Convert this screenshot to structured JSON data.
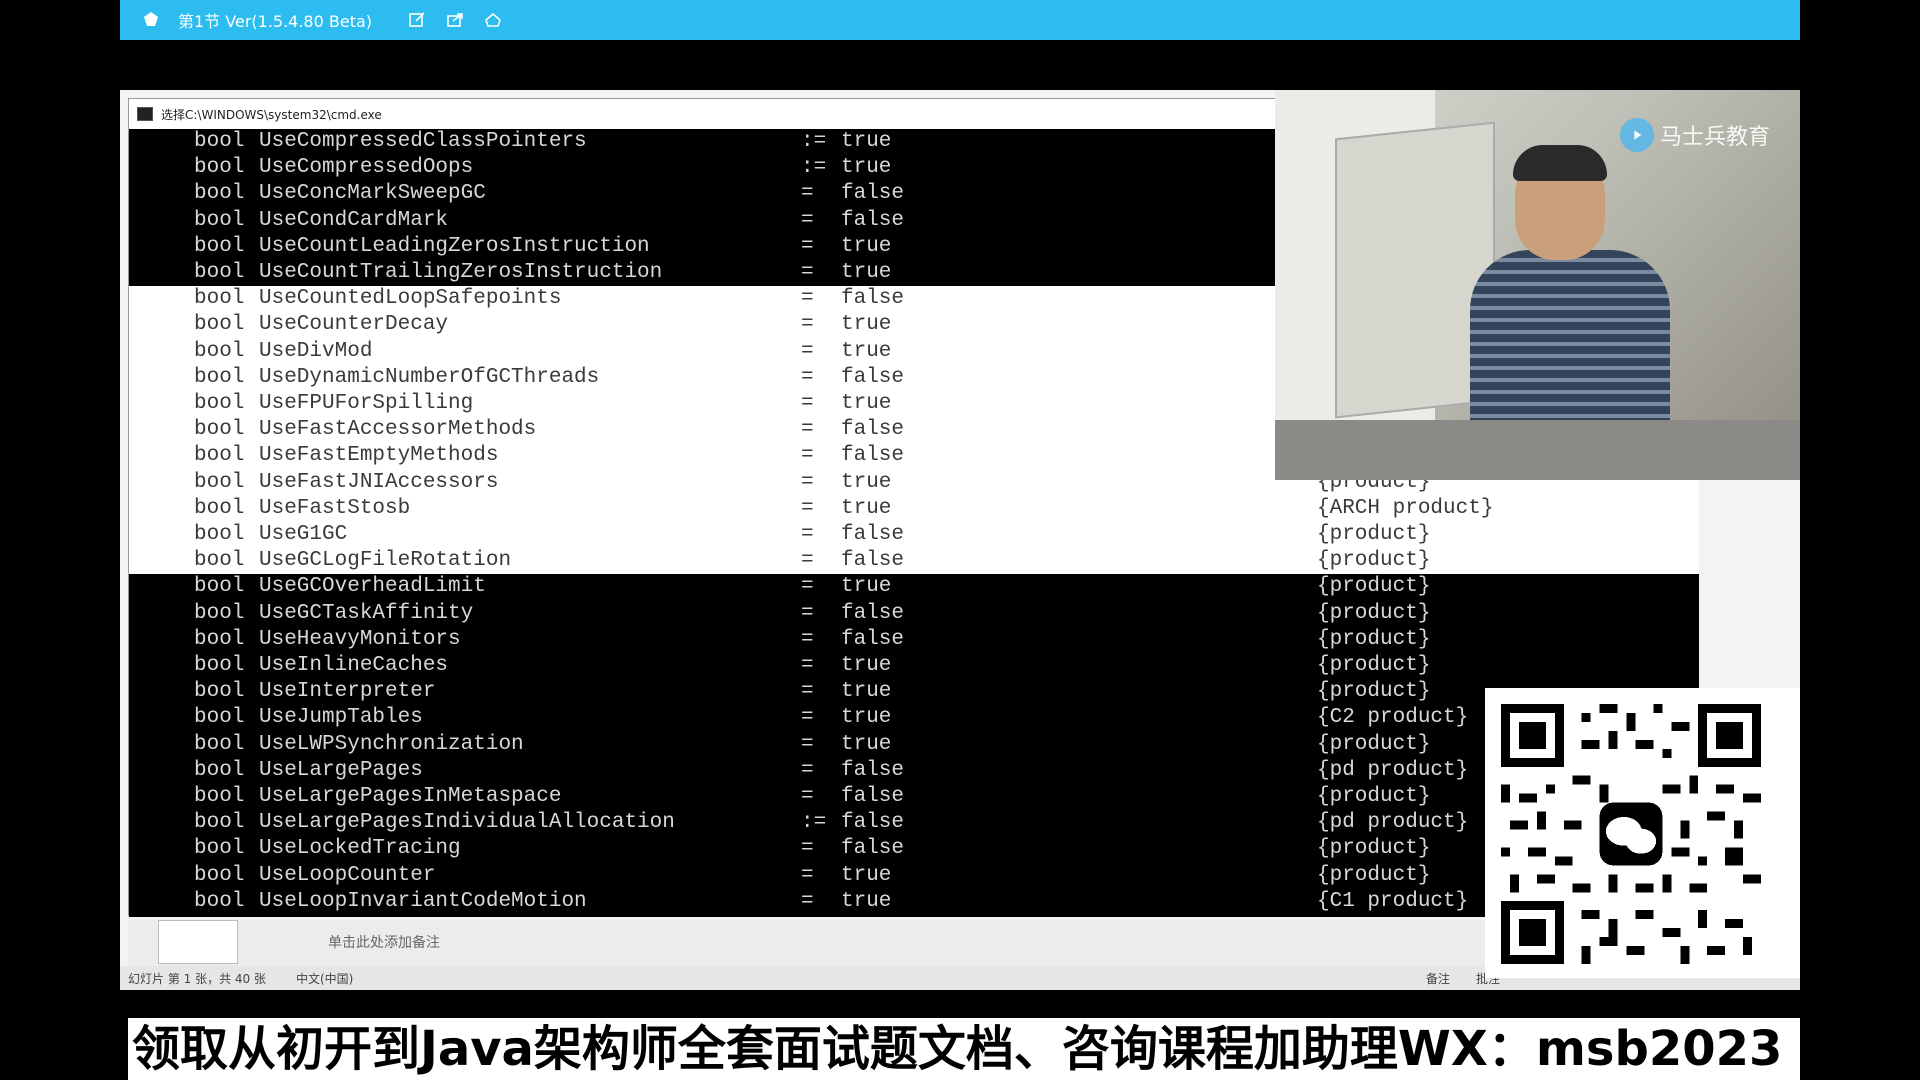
{
  "app": {
    "title": "第1节 Ver(1.5.4.80 Beta)"
  },
  "cmd": {
    "window_title": "选择C:\\WINDOWS\\system32\\cmd.exe",
    "rows": [
      {
        "type": "bool",
        "name": "UseCompressedClassPointers",
        "op": ":=",
        "value": "true",
        "kind": "",
        "selected": false
      },
      {
        "type": "bool",
        "name": "UseCompressedOops",
        "op": ":=",
        "value": "true",
        "kind": "",
        "selected": false
      },
      {
        "type": "bool",
        "name": "UseConcMarkSweepGC",
        "op": "=",
        "value": "false",
        "kind": "",
        "selected": false
      },
      {
        "type": "bool",
        "name": "UseCondCardMark",
        "op": "=",
        "value": "false",
        "kind": "",
        "selected": false
      },
      {
        "type": "bool",
        "name": "UseCountLeadingZerosInstruction",
        "op": "=",
        "value": "true",
        "kind": "",
        "selected": false
      },
      {
        "type": "bool",
        "name": "UseCountTrailingZerosInstruction",
        "op": "=",
        "value": "true",
        "kind": "",
        "selected": false
      },
      {
        "type": "bool",
        "name": "UseCountedLoopSafepoints",
        "op": "=",
        "value": "false",
        "kind": "",
        "selected": true
      },
      {
        "type": "bool",
        "name": "UseCounterDecay",
        "op": "=",
        "value": "true",
        "kind": "",
        "selected": true
      },
      {
        "type": "bool",
        "name": "UseDivMod",
        "op": "=",
        "value": "true",
        "kind": "",
        "selected": true
      },
      {
        "type": "bool",
        "name": "UseDynamicNumberOfGCThreads",
        "op": "=",
        "value": "false",
        "kind": "",
        "selected": true
      },
      {
        "type": "bool",
        "name": "UseFPUForSpilling",
        "op": "=",
        "value": "true",
        "kind": "",
        "selected": true
      },
      {
        "type": "bool",
        "name": "UseFastAccessorMethods",
        "op": "=",
        "value": "false",
        "kind": "",
        "selected": true
      },
      {
        "type": "bool",
        "name": "UseFastEmptyMethods",
        "op": "=",
        "value": "false",
        "kind": "",
        "selected": true
      },
      {
        "type": "bool",
        "name": "UseFastJNIAccessors",
        "op": "=",
        "value": "true",
        "kind": "{product}",
        "selected": true
      },
      {
        "type": "bool",
        "name": "UseFastStosb",
        "op": "=",
        "value": "true",
        "kind": "{ARCH product}",
        "selected": true
      },
      {
        "type": "bool",
        "name": "UseG1GC",
        "op": "=",
        "value": "false",
        "kind": "{product}",
        "selected": true
      },
      {
        "type": "bool",
        "name": "UseGCLogFileRotation",
        "op": "=",
        "value": "false",
        "kind": "{product}",
        "selected": true
      },
      {
        "type": "bool",
        "name": "UseGCOverheadLimit",
        "op": "=",
        "value": "true",
        "kind": "{product}",
        "selected": false
      },
      {
        "type": "bool",
        "name": "UseGCTaskAffinity",
        "op": "=",
        "value": "false",
        "kind": "{product}",
        "selected": false
      },
      {
        "type": "bool",
        "name": "UseHeavyMonitors",
        "op": "=",
        "value": "false",
        "kind": "{product}",
        "selected": false
      },
      {
        "type": "bool",
        "name": "UseInlineCaches",
        "op": "=",
        "value": "true",
        "kind": "{product}",
        "selected": false
      },
      {
        "type": "bool",
        "name": "UseInterpreter",
        "op": "=",
        "value": "true",
        "kind": "{product}",
        "selected": false
      },
      {
        "type": "bool",
        "name": "UseJumpTables",
        "op": "=",
        "value": "true",
        "kind": "{C2 product}",
        "selected": false
      },
      {
        "type": "bool",
        "name": "UseLWPSynchronization",
        "op": "=",
        "value": "true",
        "kind": "{product}",
        "selected": false
      },
      {
        "type": "bool",
        "name": "UseLargePages",
        "op": "=",
        "value": "false",
        "kind": "{pd product}",
        "selected": false
      },
      {
        "type": "bool",
        "name": "UseLargePagesInMetaspace",
        "op": "=",
        "value": "false",
        "kind": "{product}",
        "selected": false
      },
      {
        "type": "bool",
        "name": "UseLargePagesIndividualAllocation",
        "op": ":=",
        "value": "false",
        "kind": "{pd product}",
        "selected": false
      },
      {
        "type": "bool",
        "name": "UseLockedTracing",
        "op": "=",
        "value": "false",
        "kind": "{product}",
        "selected": false
      },
      {
        "type": "bool",
        "name": "UseLoopCounter",
        "op": "=",
        "value": "true",
        "kind": "{product}",
        "selected": false
      },
      {
        "type": "bool",
        "name": "UseLoopInvariantCodeMotion",
        "op": "=",
        "value": "true",
        "kind": "{C1 product}",
        "selected": false
      }
    ]
  },
  "webcam": {
    "brand": "马士兵教育"
  },
  "notes": {
    "placeholder": "单击此处添加备注"
  },
  "status": {
    "slide_info": "幻灯片 第 1 张，共 40 张",
    "language": "中文(中国)",
    "notes_btn": "备注",
    "comments_btn": "批注"
  },
  "banner": {
    "text": "领取从初开到Java架构师全套面试题文档、咨询课程加助理WX：msb2023"
  }
}
